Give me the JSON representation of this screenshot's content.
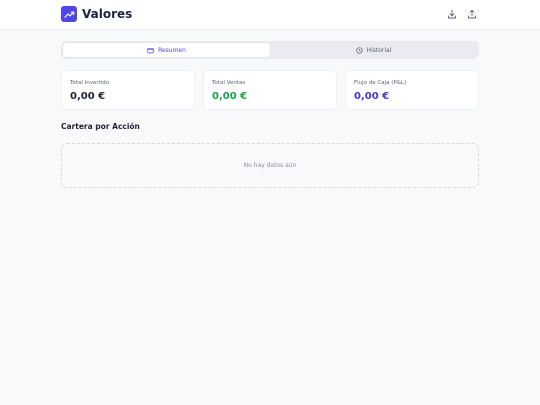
{
  "app": {
    "title": "Valores"
  },
  "tabs": [
    {
      "label": "Resumen",
      "icon": "wallet-icon",
      "active": true
    },
    {
      "label": "Historial",
      "icon": "clock-icon",
      "active": false
    }
  ],
  "summary": [
    {
      "label": "Total Invertido",
      "value": "0,00 €",
      "color": "#1f2333"
    },
    {
      "label": "Total Ventas",
      "value": "0,00 €",
      "color": "#16a34a"
    },
    {
      "label": "Flujo de Caja (P&L)",
      "value": "0,00 €",
      "color": "#4338ca"
    }
  ],
  "portfolio": {
    "title": "Cartera por Acción",
    "empty_text": "No hay datos aún"
  },
  "colors": {
    "accent": "#4f46e5",
    "positive": "#16a34a"
  }
}
